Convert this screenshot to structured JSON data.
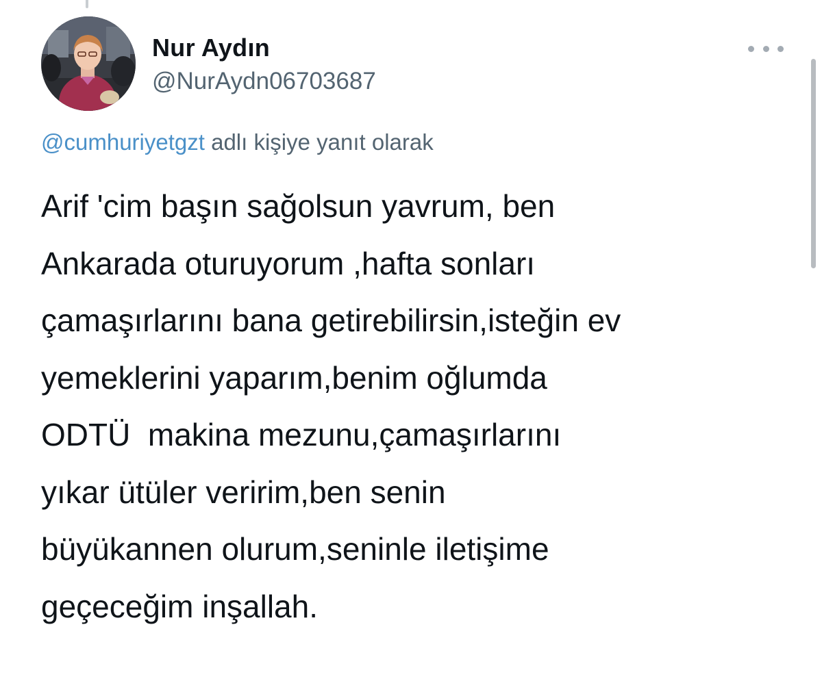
{
  "author": {
    "display_name": "Nur Aydın",
    "username": "@NurAydn06703687"
  },
  "reply_context": {
    "mention": "@cumhuriyetgzt",
    "suffix": " adlı kişiye yanıt olarak"
  },
  "tweet": {
    "lines": [
      "Arif 'cim başın sağolsun yavrum, ben",
      "Ankarada oturuyorum ,hafta sonları",
      "çamaşırlarını bana getirebilirsin,isteğin ev",
      "yemeklerini yaparım,benim oğlumda",
      "ODTÜ  makina mezunu,çamaşırlarını",
      "yıkar ütüler veririm,ben senin",
      "büyükannen olurum,seninle iletişime",
      "geçeceğim inşallah."
    ]
  },
  "icons": {
    "more": "more-options-icon",
    "avatar": "profile-photo"
  },
  "colors": {
    "text": "#0f1419",
    "secondary": "#536471",
    "mention": "#4a90c8"
  }
}
